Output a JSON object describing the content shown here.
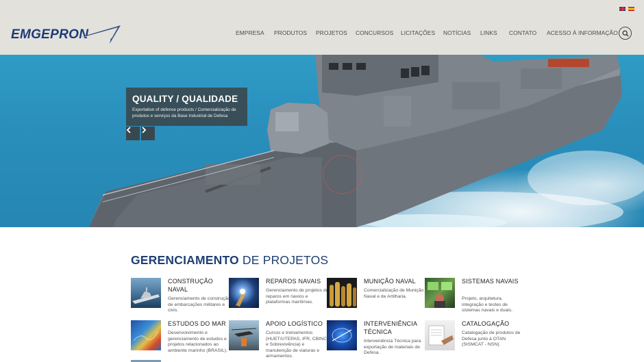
{
  "header": {
    "logo_text": "EMGEPRON",
    "flags": [
      "english-flag",
      "spanish-flag"
    ],
    "nav": [
      "EMPRESA",
      "PRODUTOS",
      "PROJETOS",
      "CONCURSOS",
      "LICITAÇÕES",
      "NOTÍCIAS",
      "LINKS",
      "CONTATO",
      "ACESSO À INFORMAÇÃO"
    ],
    "search_icon": "search-icon"
  },
  "hero": {
    "title": "QUALITY / QUALIDADE",
    "text": "Exportation of defence products / Comercialização de produtos e serviços da Base Industrial de Defesa",
    "prev_icon": "chevron-left-icon",
    "next_icon": "chevron-right-icon"
  },
  "section": {
    "title_strong": "GERENCIAMENTO",
    "title_light": "DE PROJETOS",
    "items": [
      {
        "title": "CONSTRUÇÃO NAVAL",
        "desc": "Gerenciamento de construção de embarcações militares e civis."
      },
      {
        "title": "REPAROS NAVAIS",
        "desc": "Gerenciamento de projetos de reparos em navios e plataformas marítimas."
      },
      {
        "title": "MUNIÇÃO NAVAL",
        "desc": "Comercialização de Munição Naval e de Artilharia."
      },
      {
        "title": "SISTEMAS NAVAIS",
        "desc": "Projeto, arquitetura, integração e testes de sistemas navais e duais."
      },
      {
        "title": "ESTUDOS DO MAR",
        "desc": "Desenvolvimento e gerenciamento de estudos e projetos relacionados ao ambiente marinho (BRASIL)."
      },
      {
        "title": "APOIO LOGÍSTICO",
        "desc": "Cursos e treinamentos (HUET/UTEPAS, IFR, CBINC e Sobrevivência) e manutenção de viaturas e armamentos."
      },
      {
        "title": "INTERVENIÊNCIA TÉCNICA",
        "desc": "Interveniência Técnica para exportação de materiais de Defesa."
      },
      {
        "title": "CATALOGAÇÃO",
        "desc": "Catalogação de produtos de Defesa junto à OTAN (SISMCAT - NSN)."
      }
    ]
  },
  "colors": {
    "header_bg": "#e3e1dc",
    "brand_blue": "#1d3a78",
    "heading_blue": "#1f3f73",
    "caption_bg": "#3c3c3c"
  }
}
